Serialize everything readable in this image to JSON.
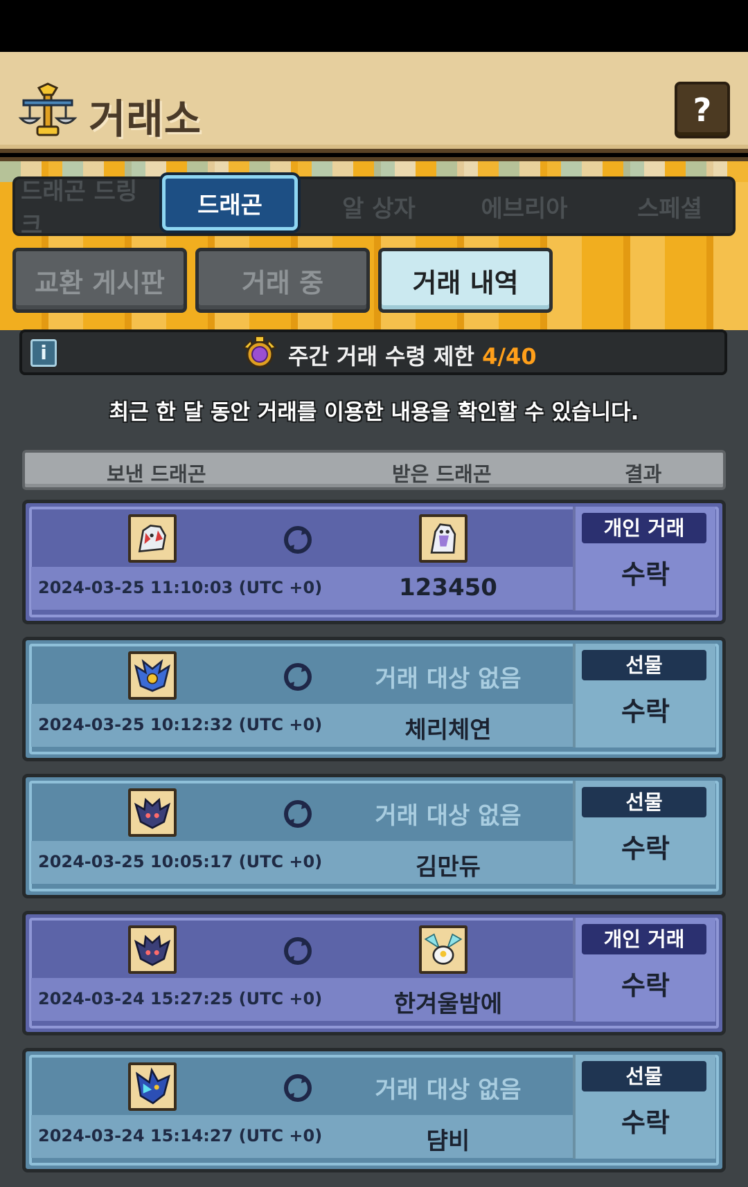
{
  "header": {
    "title": "거래소",
    "help_label": "?"
  },
  "category_tabs": [
    {
      "label": "드래곤 드링크",
      "active": false
    },
    {
      "label": "드래곤",
      "active": true
    },
    {
      "label": "알 상자",
      "active": false
    },
    {
      "label": "에브리아",
      "active": false
    },
    {
      "label": "스페셜",
      "active": false
    }
  ],
  "sub_tabs": [
    {
      "label": "교환 게시판",
      "active": false
    },
    {
      "label": "거래 중",
      "active": false
    },
    {
      "label": "거래 내역",
      "active": true
    }
  ],
  "limit": {
    "info_label": "i",
    "text": "주간 거래 수령 제한",
    "count": "4/40"
  },
  "description": "최근 한 달 동안 거래를 이용한 내용을 확인할 수 있습니다.",
  "table": {
    "headers": {
      "sent": "보낸 드래곤",
      "received": "받은 드래곤",
      "result": "결과"
    },
    "rows": [
      {
        "type": "개인 거래",
        "kind": "private",
        "timestamp": "2024-03-25 11:10:03 (UTC +0)",
        "received_text": "",
        "partner": "123450",
        "result": "수락",
        "sent_icon": "white-red-dragon-icon",
        "recv_icon": "white-purple-dragon-icon"
      },
      {
        "type": "선물",
        "kind": "gift",
        "timestamp": "2024-03-25 10:12:32 (UTC +0)",
        "received_text": "거래 대상 없음",
        "partner": "체리체연",
        "result": "수락",
        "sent_icon": "blue-gold-dragon-icon",
        "recv_icon": ""
      },
      {
        "type": "선물",
        "kind": "gift",
        "timestamp": "2024-03-25 10:05:17 (UTC +0)",
        "received_text": "거래 대상 없음",
        "partner": "김만듀",
        "result": "수락",
        "sent_icon": "dark-purple-dragon-icon",
        "recv_icon": ""
      },
      {
        "type": "개인 거래",
        "kind": "private",
        "timestamp": "2024-03-24 15:27:25 (UTC +0)",
        "received_text": "",
        "partner": "한겨울밤에",
        "result": "수락",
        "sent_icon": "dark-purple-dragon-icon",
        "recv_icon": "cyan-winged-dragon-icon"
      },
      {
        "type": "선물",
        "kind": "gift",
        "timestamp": "2024-03-24 15:14:27 (UTC +0)",
        "received_text": "거래 대상 없음",
        "partner": "댬비",
        "result": "수락",
        "sent_icon": "blue-cyan-dragon-icon",
        "recv_icon": ""
      }
    ]
  }
}
